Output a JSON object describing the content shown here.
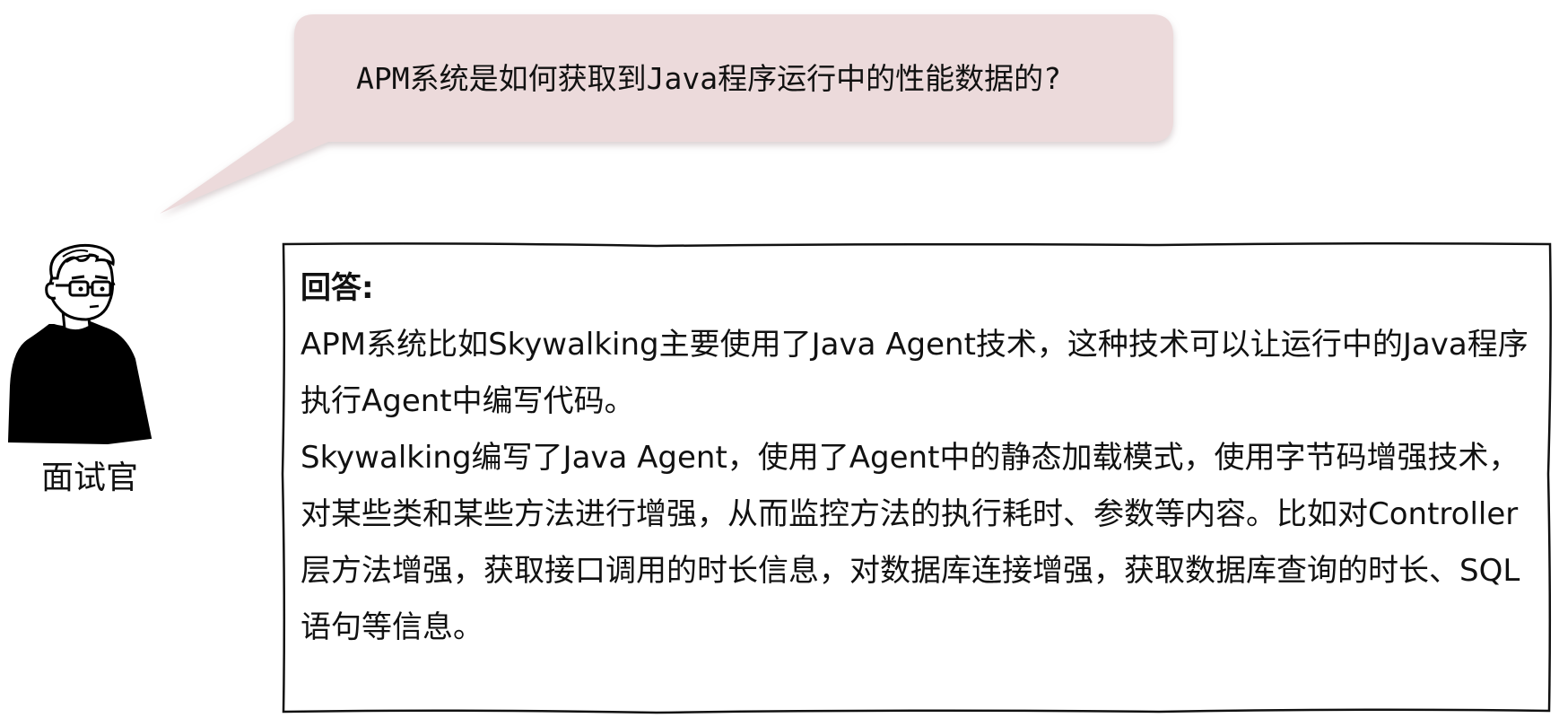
{
  "question": {
    "text": "APM系统是如何获取到Java程序运行中的性能数据的?",
    "bubble_color": "#ecdadb",
    "bubble_shadow": "#d9cacb"
  },
  "interviewer": {
    "label": "面试官",
    "icon": "interviewer-avatar-icon"
  },
  "answer": {
    "heading": "回答:",
    "paragraphs": [
      "APM系统比如Skywalking主要使用了Java Agent技术，这种技术可以让运行中的Java程序执行Agent中编写代码。",
      "Skywalking编写了Java Agent，使用了Agent中的静态加载模式，使用字节码增强技术，对某些类和某些方法进行增强，从而监控方法的执行耗时、参数等内容。比如对Controller层方法增强，获取接口调用的时长信息，对数据库连接增强，获取数据库查询的时长、SQL语句等信息。"
    ],
    "frame_color": "#111111"
  }
}
